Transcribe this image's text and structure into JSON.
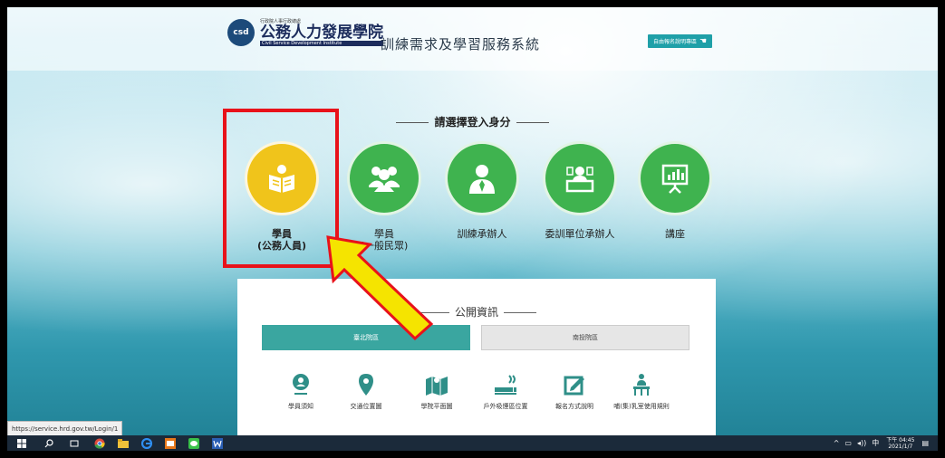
{
  "header": {
    "logo_mark": "csd",
    "logo_top": "行政院人事行政總處",
    "logo_name": "公務人力發展學院",
    "logo_sub": "Civil Service Development Institute",
    "system_title": "訓練需求及學習服務系統",
    "manual_button": "自由報名說明專區"
  },
  "login": {
    "heading": "請選擇登入身分",
    "roles": [
      {
        "line1": "學員",
        "line2": "(公務人員)",
        "color": "#f0c41b",
        "icon": "book-reader-icon"
      },
      {
        "line1": "學員",
        "line2": "(一般民眾)",
        "color": "#3fb34f",
        "icon": "group-icon"
      },
      {
        "line1": "訓練承辦人",
        "line2": "",
        "color": "#3fb34f",
        "icon": "officer-icon"
      },
      {
        "line1": "委訓單位承辦人",
        "line2": "",
        "color": "#3fb34f",
        "icon": "desk-icon"
      },
      {
        "line1": "講座",
        "line2": "",
        "color": "#3fb34f",
        "icon": "presentation-icon"
      }
    ]
  },
  "public_info": {
    "heading": "公開資訊",
    "tabs": [
      "臺北院區",
      "南投院區"
    ],
    "items": [
      {
        "label": "學員須知",
        "icon": "info-pin-icon"
      },
      {
        "label": "交通位置圖",
        "icon": "location-pin-icon"
      },
      {
        "label": "學院平面圖",
        "icon": "floor-map-icon"
      },
      {
        "label": "戶外吸煙區位置",
        "icon": "smoking-area-icon"
      },
      {
        "label": "報名方式說明",
        "icon": "edit-form-icon"
      },
      {
        "label": "哺(集)乳室使用規則",
        "icon": "nursing-room-icon"
      }
    ]
  },
  "status_bar": {
    "url": "https://service.hrd.gov.tw/Login/1"
  },
  "taskbar": {
    "time": "下午 04:45",
    "date": "2021/1/7",
    "ime": "中"
  },
  "colors": {
    "highlight": "#e8121a",
    "arrow": "#f5e400",
    "accent_teal": "#3aa6a0"
  }
}
